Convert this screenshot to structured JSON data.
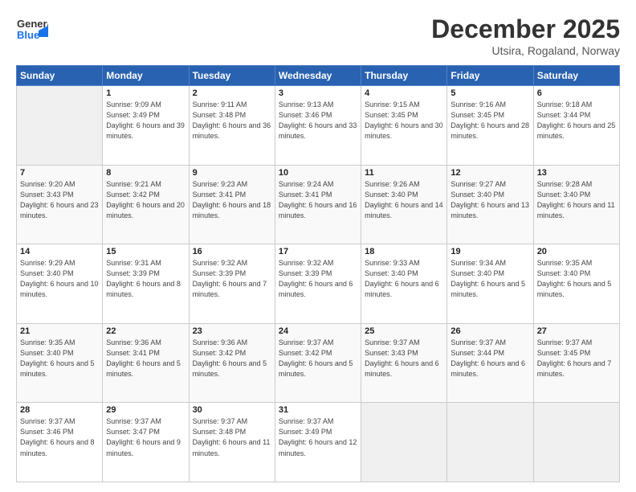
{
  "logo": {
    "general": "General",
    "blue": "Blue"
  },
  "header": {
    "month": "December 2025",
    "location": "Utsira, Rogaland, Norway"
  },
  "weekdays": [
    "Sunday",
    "Monday",
    "Tuesday",
    "Wednesday",
    "Thursday",
    "Friday",
    "Saturday"
  ],
  "weeks": [
    [
      {
        "day": "",
        "sunrise": "",
        "sunset": "",
        "daylight": ""
      },
      {
        "day": "1",
        "sunrise": "Sunrise: 9:09 AM",
        "sunset": "Sunset: 3:49 PM",
        "daylight": "Daylight: 6 hours and 39 minutes."
      },
      {
        "day": "2",
        "sunrise": "Sunrise: 9:11 AM",
        "sunset": "Sunset: 3:48 PM",
        "daylight": "Daylight: 6 hours and 36 minutes."
      },
      {
        "day": "3",
        "sunrise": "Sunrise: 9:13 AM",
        "sunset": "Sunset: 3:46 PM",
        "daylight": "Daylight: 6 hours and 33 minutes."
      },
      {
        "day": "4",
        "sunrise": "Sunrise: 9:15 AM",
        "sunset": "Sunset: 3:45 PM",
        "daylight": "Daylight: 6 hours and 30 minutes."
      },
      {
        "day": "5",
        "sunrise": "Sunrise: 9:16 AM",
        "sunset": "Sunset: 3:45 PM",
        "daylight": "Daylight: 6 hours and 28 minutes."
      },
      {
        "day": "6",
        "sunrise": "Sunrise: 9:18 AM",
        "sunset": "Sunset: 3:44 PM",
        "daylight": "Daylight: 6 hours and 25 minutes."
      }
    ],
    [
      {
        "day": "7",
        "sunrise": "Sunrise: 9:20 AM",
        "sunset": "Sunset: 3:43 PM",
        "daylight": "Daylight: 6 hours and 23 minutes."
      },
      {
        "day": "8",
        "sunrise": "Sunrise: 9:21 AM",
        "sunset": "Sunset: 3:42 PM",
        "daylight": "Daylight: 6 hours and 20 minutes."
      },
      {
        "day": "9",
        "sunrise": "Sunrise: 9:23 AM",
        "sunset": "Sunset: 3:41 PM",
        "daylight": "Daylight: 6 hours and 18 minutes."
      },
      {
        "day": "10",
        "sunrise": "Sunrise: 9:24 AM",
        "sunset": "Sunset: 3:41 PM",
        "daylight": "Daylight: 6 hours and 16 minutes."
      },
      {
        "day": "11",
        "sunrise": "Sunrise: 9:26 AM",
        "sunset": "Sunset: 3:40 PM",
        "daylight": "Daylight: 6 hours and 14 minutes."
      },
      {
        "day": "12",
        "sunrise": "Sunrise: 9:27 AM",
        "sunset": "Sunset: 3:40 PM",
        "daylight": "Daylight: 6 hours and 13 minutes."
      },
      {
        "day": "13",
        "sunrise": "Sunrise: 9:28 AM",
        "sunset": "Sunset: 3:40 PM",
        "daylight": "Daylight: 6 hours and 11 minutes."
      }
    ],
    [
      {
        "day": "14",
        "sunrise": "Sunrise: 9:29 AM",
        "sunset": "Sunset: 3:40 PM",
        "daylight": "Daylight: 6 hours and 10 minutes."
      },
      {
        "day": "15",
        "sunrise": "Sunrise: 9:31 AM",
        "sunset": "Sunset: 3:39 PM",
        "daylight": "Daylight: 6 hours and 8 minutes."
      },
      {
        "day": "16",
        "sunrise": "Sunrise: 9:32 AM",
        "sunset": "Sunset: 3:39 PM",
        "daylight": "Daylight: 6 hours and 7 minutes."
      },
      {
        "day": "17",
        "sunrise": "Sunrise: 9:32 AM",
        "sunset": "Sunset: 3:39 PM",
        "daylight": "Daylight: 6 hours and 6 minutes."
      },
      {
        "day": "18",
        "sunrise": "Sunrise: 9:33 AM",
        "sunset": "Sunset: 3:40 PM",
        "daylight": "Daylight: 6 hours and 6 minutes."
      },
      {
        "day": "19",
        "sunrise": "Sunrise: 9:34 AM",
        "sunset": "Sunset: 3:40 PM",
        "daylight": "Daylight: 6 hours and 5 minutes."
      },
      {
        "day": "20",
        "sunrise": "Sunrise: 9:35 AM",
        "sunset": "Sunset: 3:40 PM",
        "daylight": "Daylight: 6 hours and 5 minutes."
      }
    ],
    [
      {
        "day": "21",
        "sunrise": "Sunrise: 9:35 AM",
        "sunset": "Sunset: 3:40 PM",
        "daylight": "Daylight: 6 hours and 5 minutes."
      },
      {
        "day": "22",
        "sunrise": "Sunrise: 9:36 AM",
        "sunset": "Sunset: 3:41 PM",
        "daylight": "Daylight: 6 hours and 5 minutes."
      },
      {
        "day": "23",
        "sunrise": "Sunrise: 9:36 AM",
        "sunset": "Sunset: 3:42 PM",
        "daylight": "Daylight: 6 hours and 5 minutes."
      },
      {
        "day": "24",
        "sunrise": "Sunrise: 9:37 AM",
        "sunset": "Sunset: 3:42 PM",
        "daylight": "Daylight: 6 hours and 5 minutes."
      },
      {
        "day": "25",
        "sunrise": "Sunrise: 9:37 AM",
        "sunset": "Sunset: 3:43 PM",
        "daylight": "Daylight: 6 hours and 6 minutes."
      },
      {
        "day": "26",
        "sunrise": "Sunrise: 9:37 AM",
        "sunset": "Sunset: 3:44 PM",
        "daylight": "Daylight: 6 hours and 6 minutes."
      },
      {
        "day": "27",
        "sunrise": "Sunrise: 9:37 AM",
        "sunset": "Sunset: 3:45 PM",
        "daylight": "Daylight: 6 hours and 7 minutes."
      }
    ],
    [
      {
        "day": "28",
        "sunrise": "Sunrise: 9:37 AM",
        "sunset": "Sunset: 3:46 PM",
        "daylight": "Daylight: 6 hours and 8 minutes."
      },
      {
        "day": "29",
        "sunrise": "Sunrise: 9:37 AM",
        "sunset": "Sunset: 3:47 PM",
        "daylight": "Daylight: 6 hours and 9 minutes."
      },
      {
        "day": "30",
        "sunrise": "Sunrise: 9:37 AM",
        "sunset": "Sunset: 3:48 PM",
        "daylight": "Daylight: 6 hours and 11 minutes."
      },
      {
        "day": "31",
        "sunrise": "Sunrise: 9:37 AM",
        "sunset": "Sunset: 3:49 PM",
        "daylight": "Daylight: 6 hours and 12 minutes."
      },
      {
        "day": "",
        "sunrise": "",
        "sunset": "",
        "daylight": ""
      },
      {
        "day": "",
        "sunrise": "",
        "sunset": "",
        "daylight": ""
      },
      {
        "day": "",
        "sunrise": "",
        "sunset": "",
        "daylight": ""
      }
    ]
  ]
}
